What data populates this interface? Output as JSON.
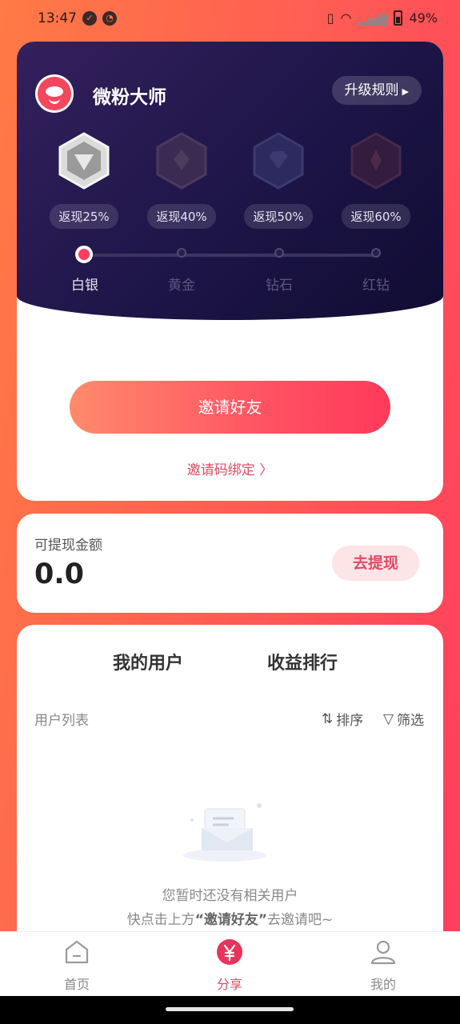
{
  "status_bar": {
    "time": "13:47",
    "battery": "49%"
  },
  "header": {
    "app_name": "微粉大师",
    "rule_label": "升级规则"
  },
  "levels": [
    {
      "name": "白银",
      "cashback": "返现25%",
      "active": true
    },
    {
      "name": "黄金",
      "cashback": "返现40%",
      "active": false
    },
    {
      "name": "钻石",
      "cashback": "返现50%",
      "active": false
    },
    {
      "name": "红钻",
      "cashback": "返现60%",
      "active": false
    }
  ],
  "invite": {
    "button_label": "邀请好友",
    "code_link": "邀请码绑定"
  },
  "balance": {
    "label": "可提现金额",
    "value": "0.0",
    "withdraw_label": "去提现"
  },
  "tabs": [
    {
      "label": "我的用户"
    },
    {
      "label": "收益排行"
    }
  ],
  "user_list": {
    "title": "用户列表",
    "sort_label": "排序",
    "filter_label": "筛选",
    "empty_line1": "您暂时还没有相关用户",
    "empty_line2_prefix": "快点击上方",
    "empty_line2_emphasis": "“邀请好友”",
    "empty_line2_suffix": "去邀请吧~"
  },
  "bottom_nav": [
    {
      "label": "首页",
      "icon": "home-icon",
      "active": false
    },
    {
      "label": "分享",
      "icon": "yuan-icon",
      "active": true
    },
    {
      "label": "我的",
      "icon": "user-icon",
      "active": false
    }
  ],
  "colors": {
    "accent": "#e24a64",
    "dark_panel": "#1d1547",
    "gradient_start": "#ff7a45",
    "gradient_end": "#ff3d5e"
  }
}
